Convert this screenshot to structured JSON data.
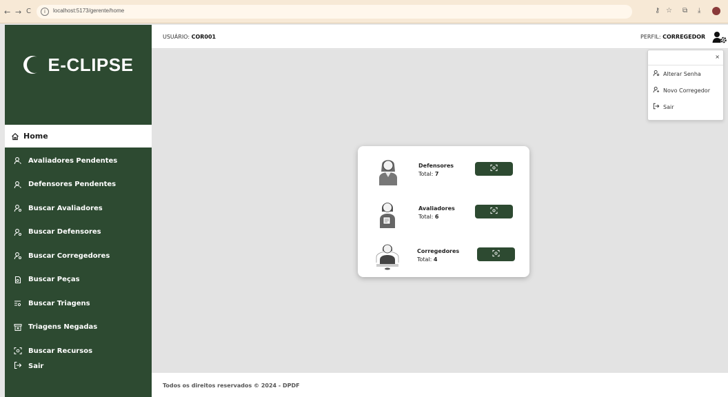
{
  "browser": {
    "url": "localhost:5173/gerente/home",
    "nav_back": "←",
    "nav_forward": "→",
    "nav_reload": "C"
  },
  "app": {
    "logo_text": "E-CLIPSE",
    "brand_color": "#2d4a31"
  },
  "header": {
    "user_label": "USUÁRIO: ",
    "user_value": "COR001",
    "perfil_label": "PERFIL: ",
    "perfil_value": "CORREGEDOR"
  },
  "sidebar": {
    "home_label": "Home",
    "items": [
      {
        "label": "Avaliadores Pendentes",
        "icon": "user-icon"
      },
      {
        "label": "Defensores Pendentes",
        "icon": "user-icon"
      },
      {
        "label": "Buscar Avaliadores",
        "icon": "user-search-icon"
      },
      {
        "label": "Buscar Defensores",
        "icon": "user-search-icon"
      },
      {
        "label": "Buscar Corregedores",
        "icon": "user-search-icon"
      },
      {
        "label": "Buscar Peças",
        "icon": "file-icon"
      },
      {
        "label": "Buscar Triagens",
        "icon": "list-search-icon"
      },
      {
        "label": "Triagens Negadas",
        "icon": "archive-x-icon"
      },
      {
        "label": "Buscar Recursos",
        "icon": "scan-icon"
      }
    ],
    "exit_label": "Sair"
  },
  "dropdown": {
    "close": "×",
    "items": [
      {
        "label": "Alterar Senha",
        "icon": "user-key-icon"
      },
      {
        "label": "Novo Corregedor",
        "icon": "user-plus-icon"
      },
      {
        "label": "Sair",
        "icon": "logout-icon"
      }
    ]
  },
  "card": {
    "rows": [
      {
        "title": "Defensores",
        "total_label": "Total: ",
        "total_value": "7"
      },
      {
        "title": "Avaliadores",
        "total_label": "Total: ",
        "total_value": "6"
      },
      {
        "title": "Corregedores",
        "total_label": "Total: ",
        "total_value": "4"
      }
    ]
  },
  "footer": {
    "text": "Todos os direitos reservados © 2024 - DPDF"
  }
}
